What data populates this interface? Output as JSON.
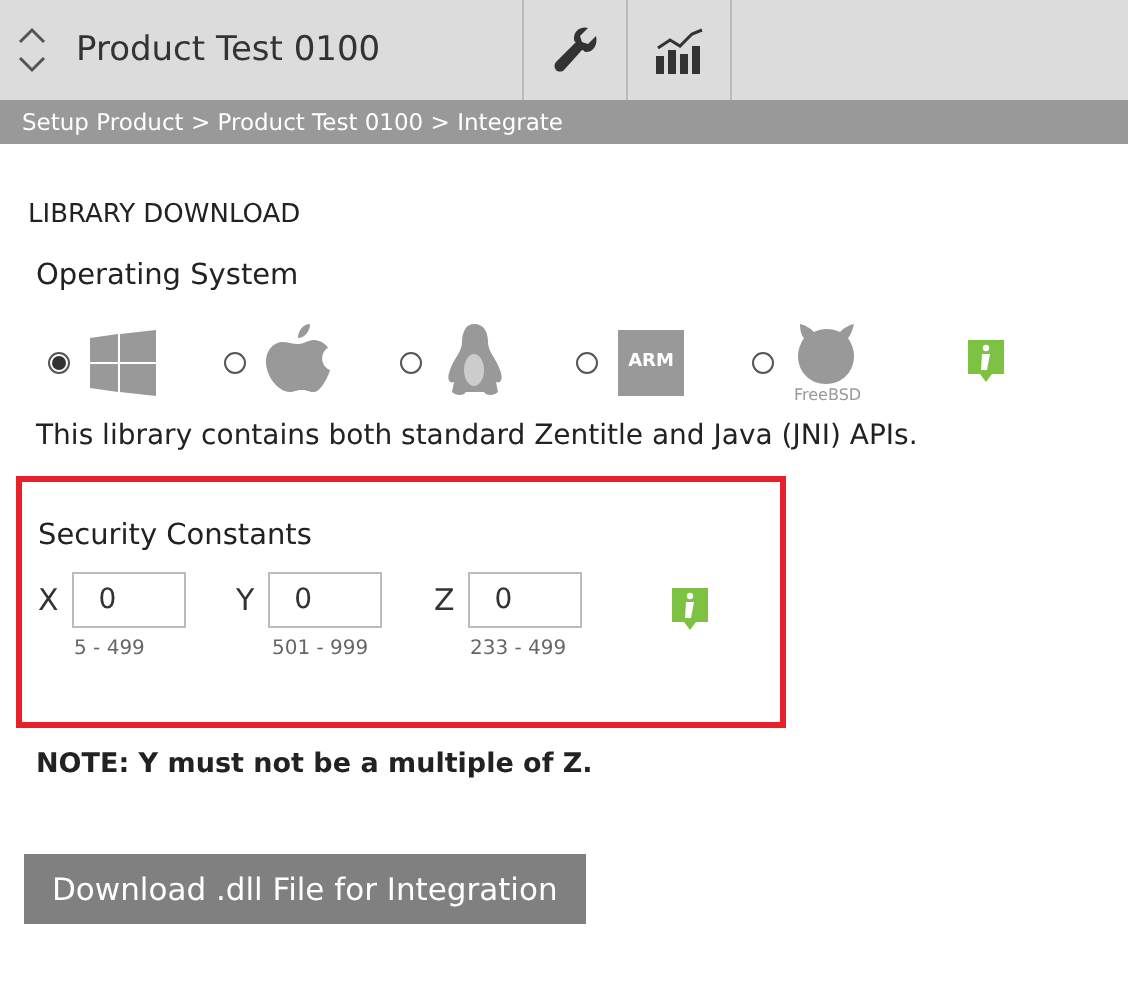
{
  "header": {
    "title": "Product Test 0100",
    "tools": [
      {
        "kind": "wrench",
        "selected": false
      },
      {
        "kind": "chart",
        "selected": false
      }
    ]
  },
  "breadcrumb": "Setup Product > Product Test 0100 > Integrate",
  "section_title": "LIBRARY DOWNLOAD",
  "os": {
    "label": "Operating System",
    "options": [
      {
        "kind": "windows",
        "selected": true
      },
      {
        "kind": "apple",
        "selected": false
      },
      {
        "kind": "linux",
        "selected": false
      },
      {
        "kind": "arm",
        "label": "ARM",
        "selected": false
      },
      {
        "kind": "freebsd",
        "label": "FreeBSD",
        "selected": false
      }
    ]
  },
  "description": "This library contains both standard Zentitle and Java (JNI) APIs.",
  "security": {
    "title": "Security Constants",
    "fields": [
      {
        "label": "X",
        "value": "0",
        "range": "5 - 499"
      },
      {
        "label": "Y",
        "value": "0",
        "range": "501 - 999"
      },
      {
        "label": "Z",
        "value": "0",
        "range": "233 - 499"
      }
    ]
  },
  "note": "NOTE: Y must not be a multiple of Z.",
  "download_button": "Download .dll File for Integration"
}
